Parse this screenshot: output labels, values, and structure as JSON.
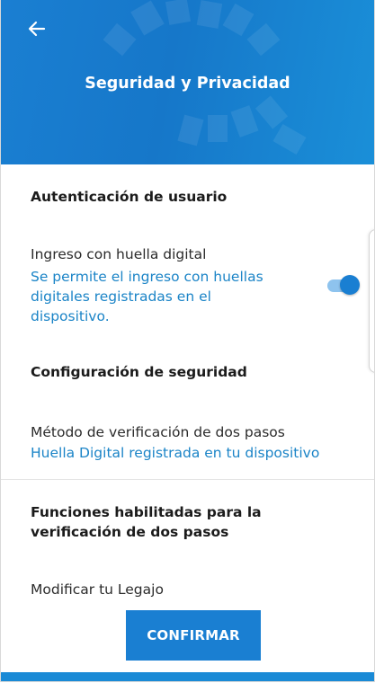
{
  "header": {
    "title": "Seguridad y Privacidad",
    "back_icon": "arrow-left-icon",
    "background_color": "#1a7fd2"
  },
  "user_auth": {
    "section_title": "Autenticación de usuario",
    "fingerprint_login": {
      "title": "Ingreso con huella digital",
      "description_lines": [
        "Se permite el ingreso con huellas",
        "digitales registradas en el",
        "dispositivo."
      ],
      "toggle_on": true
    }
  },
  "security_config": {
    "section_title": "Configuración de seguridad",
    "two_step": {
      "title": "Método de verificación de dos pasos",
      "value": "Huella Digital registrada en tu dispositivo"
    }
  },
  "enabled_functions": {
    "section_title_lines": [
      "Funciones habilitadas para la",
      "verificación de dos pasos"
    ],
    "items": [
      "Modificar tu Legajo"
    ]
  },
  "actions": {
    "confirm_label": "CONFIRMAR"
  },
  "colors": {
    "accent": "#1a7fd2",
    "link_text": "#1b84c7"
  }
}
